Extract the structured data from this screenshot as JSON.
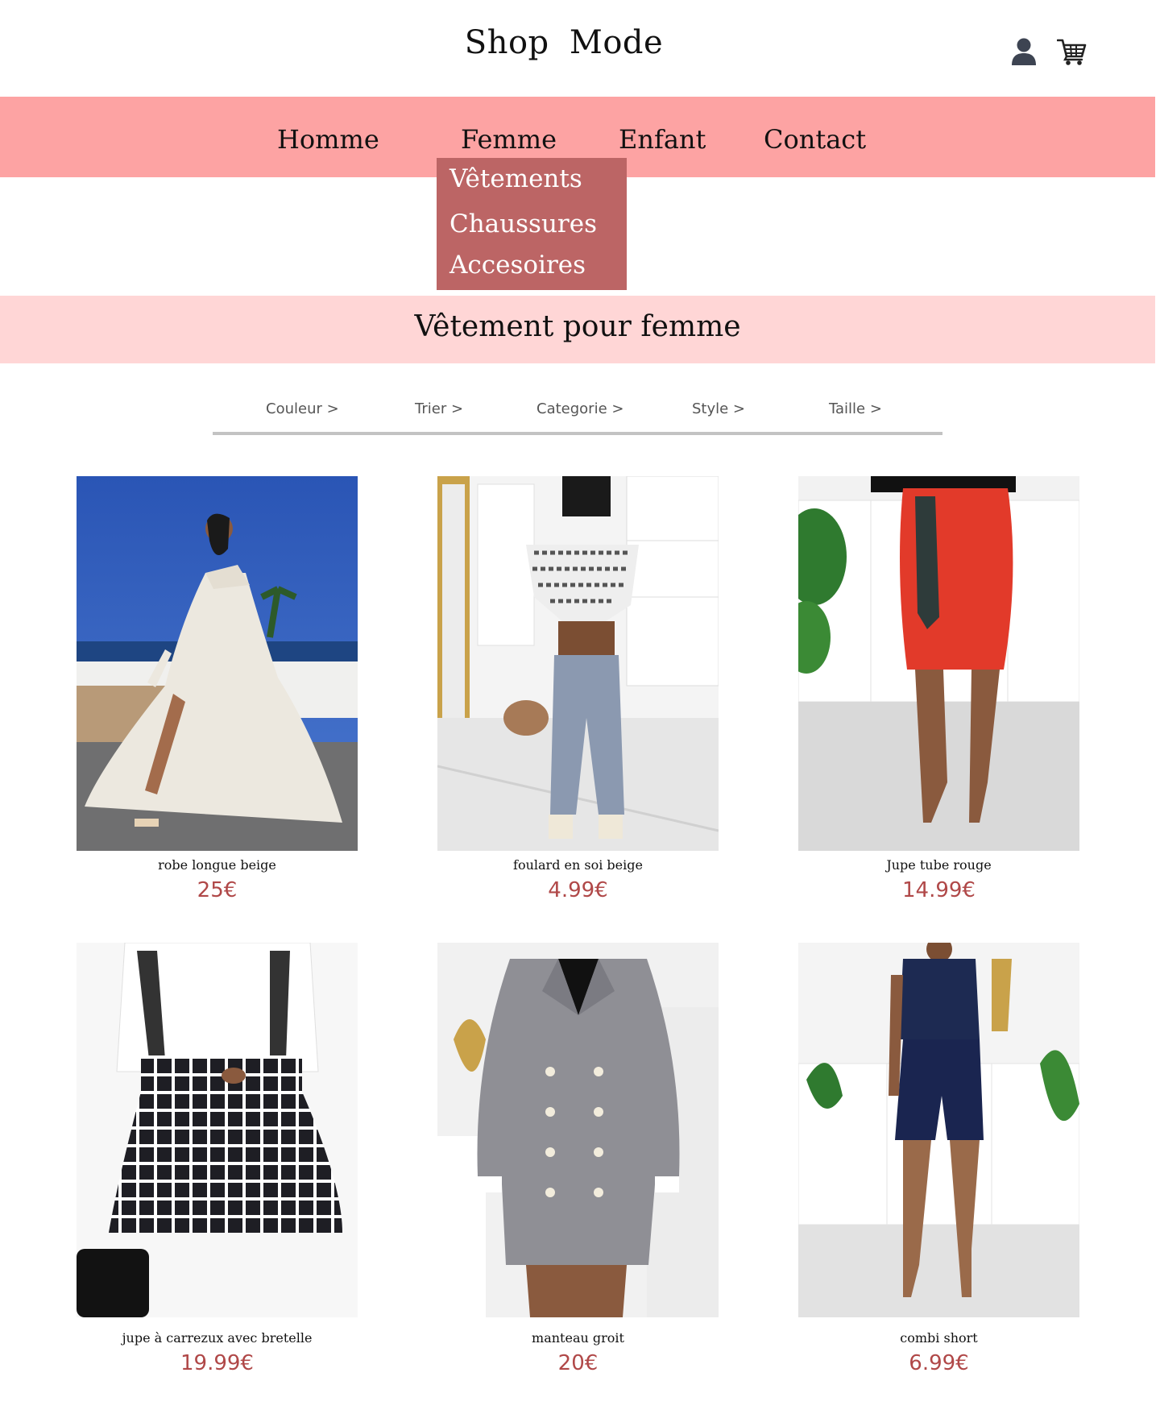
{
  "header": {
    "logo": "Shop  Mode",
    "icons": {
      "user": "user-icon",
      "cart": "cart-icon"
    }
  },
  "nav": {
    "items": [
      "Homme",
      "Femme",
      "Enfant",
      "Contact"
    ]
  },
  "dropdown": {
    "items": [
      "Vêtements",
      "Chaussures",
      "Accesoires"
    ]
  },
  "section": {
    "title": "Vêtement pour femme"
  },
  "filters": [
    "Couleur >",
    "Trier >",
    "Categorie >",
    "Style >",
    "Taille >"
  ],
  "products": [
    {
      "name": "robe longue beige",
      "price": "25€"
    },
    {
      "name": "foulard en soi beige",
      "price": "4.99€"
    },
    {
      "name": "Jupe tube rouge",
      "price": "14.99€"
    },
    {
      "name": "jupe à carrezux avec bretelle",
      "price": "19.99€"
    },
    {
      "name": "manteau groit",
      "price": "20€"
    },
    {
      "name": "combi short",
      "price": "6.99€"
    }
  ],
  "colors": {
    "nav_bg": "#fda3a3",
    "dropdown_bg": "#bc6565",
    "section_bg": "#ffd6d6",
    "price": "#b04848"
  }
}
